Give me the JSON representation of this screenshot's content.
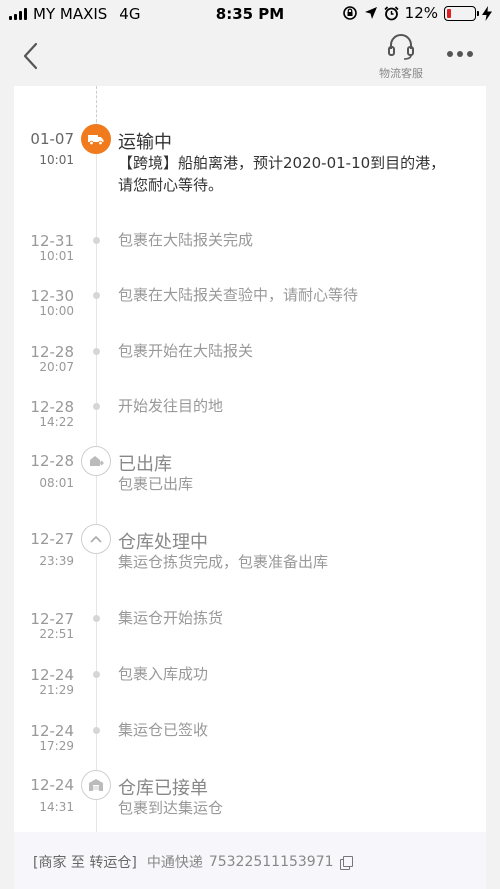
{
  "status_bar": {
    "carrier": "MY MAXIS",
    "network": "4G",
    "time": "8:35 PM",
    "battery": "12%"
  },
  "nav": {
    "service_label": "物流客服"
  },
  "timeline": [
    {
      "date": "01-07",
      "time": "10:01",
      "title": "运输中",
      "desc": "【跨境】船舶离港，预计2020-01-10到目的港，请您耐心等待。",
      "icon": "truck-icon"
    },
    {
      "date": "12-31",
      "time": "10:01",
      "desc": "包裹在大陆报关完成"
    },
    {
      "date": "12-30",
      "time": "10:00",
      "desc": "包裹在大陆报关查验中，请耐心等待"
    },
    {
      "date": "12-28",
      "time": "20:07",
      "desc": "包裹开始在大陆报关"
    },
    {
      "date": "12-28",
      "time": "14:22",
      "desc": "开始发往目的地"
    },
    {
      "date": "12-28",
      "time": "08:01",
      "title": "已出库",
      "desc": "包裹已出库",
      "icon": "outbound-icon"
    },
    {
      "date": "12-27",
      "time": "23:39",
      "title": "仓库处理中",
      "desc": "集运仓拣货完成，包裹准备出库",
      "icon": "chevron-up-icon"
    },
    {
      "date": "12-27",
      "time": "22:51",
      "desc": "集运仓开始拣货"
    },
    {
      "date": "12-24",
      "time": "21:29",
      "desc": "包裹入库成功"
    },
    {
      "date": "12-24",
      "time": "17:29",
      "desc": "集运仓已签收"
    },
    {
      "date": "12-24",
      "time": "14:31",
      "title": "仓库已接单",
      "desc": "包裹到达集运仓",
      "icon": "warehouse-icon"
    }
  ],
  "footer": {
    "route": "[商家 至 转运仓]",
    "courier": "中通快递",
    "tracking_no": "75322511153971"
  },
  "colors": {
    "accent": "#f07a1c",
    "muted": "#999999"
  }
}
